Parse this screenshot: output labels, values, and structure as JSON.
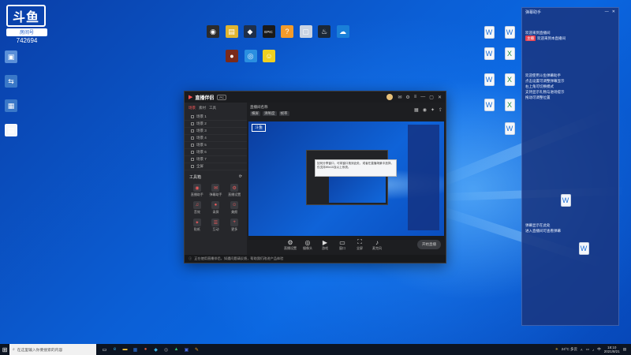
{
  "stream_logo": {
    "brand": "斗鱼",
    "sub": "房间号",
    "room": "742694"
  },
  "desktop_icons_top": [
    {
      "name": "app-1",
      "label": "",
      "color": "#2b2b2b",
      "glyph": "◉"
    },
    {
      "name": "app-2",
      "label": "",
      "color": "#e0b530",
      "glyph": "▤"
    },
    {
      "name": "app-3",
      "label": "",
      "color": "#1e2f4a",
      "glyph": "◆"
    },
    {
      "name": "app-4",
      "label": "",
      "color": "#1a1a1a",
      "glyph": "EPIC"
    },
    {
      "name": "app-5",
      "label": "",
      "color": "#f39b2a",
      "glyph": "?"
    },
    {
      "name": "app-6",
      "label": "",
      "color": "#c9d3e2",
      "glyph": "▢"
    },
    {
      "name": "steam",
      "label": "",
      "color": "#1b2838",
      "glyph": "♨"
    },
    {
      "name": "app-8",
      "label": "",
      "color": "#1a7fd8",
      "glyph": "☁"
    }
  ],
  "desktop_icons_row2": [
    {
      "name": "app-9",
      "label": "",
      "color": "#7a2a1a",
      "glyph": "●"
    },
    {
      "name": "app-10",
      "label": "",
      "color": "#2a8fe0",
      "glyph": "◎"
    },
    {
      "name": "app-11",
      "label": "",
      "color": "#f0d020",
      "glyph": "☺"
    }
  ],
  "desktop_icons_left": [
    {
      "name": "left-1",
      "color": "#5a8fd8",
      "glyph": "▣"
    },
    {
      "name": "left-2",
      "color": "#3a78c8",
      "glyph": "⇆"
    },
    {
      "name": "left-3",
      "color": "#3a78c8",
      "glyph": "▦"
    },
    {
      "name": "left-4",
      "color": "#f4f7fb",
      "glyph": "▤"
    }
  ],
  "desktop_docs_right": [
    {
      "name": "doc-1",
      "type": "doc"
    },
    {
      "name": "doc-2",
      "type": "doc"
    },
    {
      "name": "doc-3",
      "type": "doc"
    },
    {
      "name": "doc-4",
      "type": "xls"
    },
    {
      "name": "doc-5",
      "type": "doc"
    },
    {
      "name": "doc-6",
      "type": "xls"
    },
    {
      "name": "doc-7",
      "type": "doc"
    },
    {
      "name": "doc-8",
      "type": "xls"
    },
    {
      "name": "doc-9",
      "type": "doc"
    },
    {
      "name": "doc-10",
      "type": "doc"
    },
    {
      "name": "doc-11",
      "type": "doc"
    }
  ],
  "right_panel": {
    "title": "弹幕助手",
    "line1": "欢迎来到直播间",
    "badge": "主播",
    "line2": "欢迎来到本直播间",
    "tip_lines": [
      "欢迎使用斗鱼弹幕助手",
      "点击设置可调整弹幕显示",
      "右上角可切换模式",
      "支持显示礼物与进场提示",
      "拖动可调整位置"
    ],
    "footer_lines": [
      "弹幕显示在此处",
      "进入直播间可查看弹幕"
    ]
  },
  "app": {
    "name": "直播伴侣",
    "tag": "PC",
    "side_tabs": [
      "场景",
      "素材",
      "工具"
    ],
    "scenes": [
      "场景 1",
      "场景 2",
      "场景 3",
      "场景 4",
      "场景 5",
      "场景 6",
      "场景 7",
      "全屏"
    ],
    "tools_title": "工具箱",
    "tools": [
      "直播助手",
      "弹幕助手",
      "直播设置",
      "音效",
      "录屏",
      "美颜",
      "贴纸",
      "互动",
      "更多"
    ],
    "main_title": "直播间名称",
    "main_chips": [
      "横屏",
      "清晰度",
      "帧率"
    ],
    "popup_text": "如何分享窗口，可将窗口拖到此处，或者在直播场景中选择，仅支持Win10及以上系统。",
    "controls": [
      "直播设置",
      "摄像头",
      "游戏",
      "窗口",
      "全屏",
      "麦克风"
    ],
    "start_label": "开始直播",
    "status": "正在使用直播伴侣，如遇问题请反馈，帮助我们改进产品体验"
  },
  "taskbar": {
    "search_placeholder": "在这里输入你要搜索的内容",
    "weather": "24°C 多云",
    "time": "18:10",
    "date": "2021/8/21",
    "apps": [
      {
        "name": "task-view",
        "color": "#ffffff",
        "glyph": "▭"
      },
      {
        "name": "edge",
        "color": "#2ea7e0",
        "glyph": "e"
      },
      {
        "name": "explorer",
        "color": "#f3c33a",
        "glyph": "▬"
      },
      {
        "name": "store",
        "color": "#2a6fd8",
        "glyph": "▦"
      },
      {
        "name": "app-a",
        "color": "#e05a3a",
        "glyph": "●"
      },
      {
        "name": "app-b",
        "color": "#3ab0e0",
        "glyph": "◆"
      },
      {
        "name": "app-c",
        "color": "#a0a0a0",
        "glyph": "◎"
      },
      {
        "name": "app-d",
        "color": "#30c070",
        "glyph": "▲"
      },
      {
        "name": "app-e",
        "color": "#4a6ae0",
        "glyph": "▣"
      },
      {
        "name": "app-f",
        "color": "#f0a020",
        "glyph": "✎"
      }
    ]
  }
}
